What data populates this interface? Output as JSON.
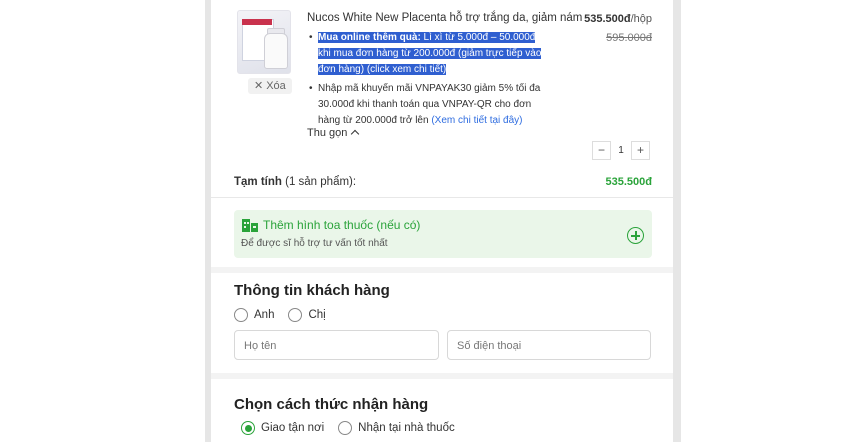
{
  "product": {
    "name": "Nucos White New Placenta hỗ trợ trắng da, giảm nám",
    "price_now": "535.500đ",
    "price_unit": "/hộp",
    "price_old": "595.000đ",
    "remove_label": "Xóa",
    "promo_1_bold": "Mua online thêm quà:",
    "promo_1_text": " Lì xì từ 5.000đ – 50.000đ khi mua đơn hàng từ 200.000đ (giảm trực tiếp vào đơn hàng) (click xem chi tiết)",
    "promo_2_text": "Nhập mã khuyến mãi VNPAYAK30 giảm 5% tối đa 30.000đ khi thanh toán qua VNPAY-QR cho đơn hàng từ 200.000đ trở lên ",
    "promo_2_link": "(Xem chi tiết tại đây)",
    "collapse_label": "Thu gọn",
    "quantity": "1"
  },
  "subtotal": {
    "label_bold": "Tạm tính",
    "label_rest": " (1 sản phẩm):",
    "value": "535.500đ"
  },
  "prescription": {
    "title": "Thêm hình toa thuốc (nếu có)",
    "subtitle": "Để được sĩ hỗ trợ tư vấn tốt nhất"
  },
  "customer": {
    "title": "Thông tin khách hàng",
    "gender_options": [
      "Anh",
      "Chị"
    ],
    "name_placeholder": "Họ tên",
    "phone_placeholder": "Số điện thoại"
  },
  "delivery": {
    "title": "Chọn cách thức nhận hàng",
    "options": [
      "Giao tận nơi",
      "Nhận tại nhà thuốc"
    ],
    "selected": "Giao tận nơi"
  },
  "colors": {
    "accent_green": "#2aa33a",
    "highlight_blue": "#2f5fd0",
    "link_blue": "#2f6de0"
  }
}
